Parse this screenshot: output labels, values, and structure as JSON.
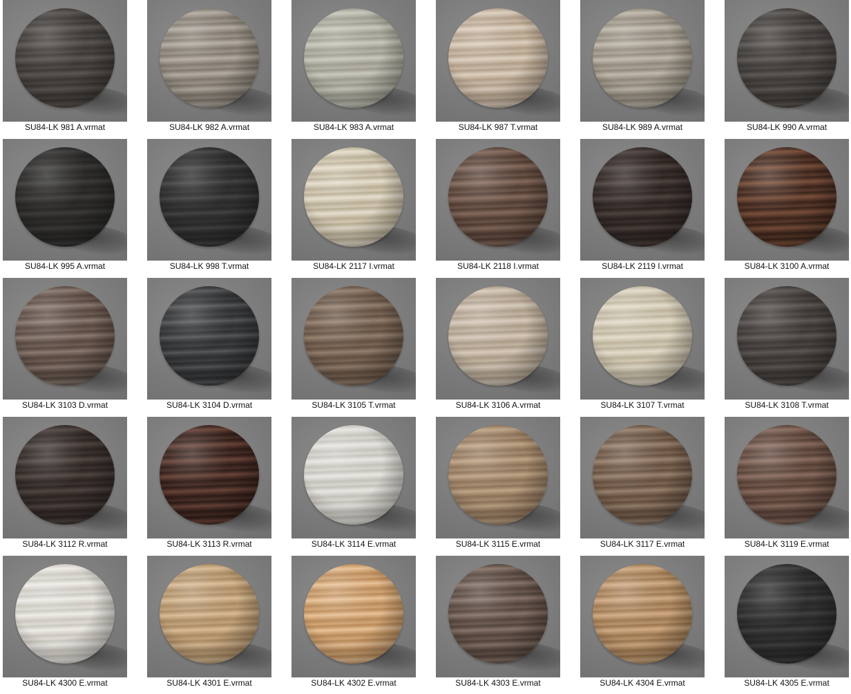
{
  "materials": [
    {
      "label": "SU84-LK 981 A.vrmat",
      "base": "#4a4643",
      "grain": "#3a3633",
      "hi": "#5a5550"
    },
    {
      "label": "SU84-LK 982 A.vrmat",
      "base": "#9a9288",
      "grain": "#7f776c",
      "hi": "#b3aca2"
    },
    {
      "label": "SU84-LK 983 A.vrmat",
      "base": "#b4b3a6",
      "grain": "#9c9b8e",
      "hi": "#cac9bd"
    },
    {
      "label": "SU84-LK 987 T.vrmat",
      "base": "#c9b8a4",
      "grain": "#b09e89",
      "hi": "#ddd0c0"
    },
    {
      "label": "SU84-LK 989 A.vrmat",
      "base": "#a9a193",
      "grain": "#8f877a",
      "hi": "#c0b9ad"
    },
    {
      "label": "SU84-LK 990 A.vrmat",
      "base": "#4b4744",
      "grain": "#3c3835",
      "hi": "#5e5955"
    },
    {
      "label": "SU84-LK 995 A.vrmat",
      "base": "#2f2e2d",
      "grain": "#262524",
      "hi": "#3c3b3a"
    },
    {
      "label": "SU84-LK 998 T.vrmat",
      "base": "#333232",
      "grain": "#2a2929",
      "hi": "#444343"
    },
    {
      "label": "SU84-LK 2117 I.vrmat",
      "base": "#d2c8b2",
      "grain": "#b8ad95",
      "hi": "#e5dece"
    },
    {
      "label": "SU84-LK 2118 I.vrmat",
      "base": "#6b5347",
      "grain": "#503c32",
      "hi": "#846a5d"
    },
    {
      "label": "SU84-LK 2119 I.vrmat",
      "base": "#3a302d",
      "grain": "#2a2220",
      "hi": "#4d423e"
    },
    {
      "label": "SU84-LK 3100 A.vrmat",
      "base": "#5a3a2c",
      "grain": "#3a241b",
      "hi": "#7a4f3a"
    },
    {
      "label": "SU84-LK 3103 D.vrmat",
      "base": "#6e5e55",
      "grain": "#56473f",
      "hi": "#8a7a70"
    },
    {
      "label": "SU84-LK 3104 D.vrmat",
      "base": "#3d3e40",
      "grain": "#2e2f31",
      "hi": "#55575a"
    },
    {
      "label": "SU84-LK 3105 T.vrmat",
      "base": "#7a6656",
      "grain": "#614f41",
      "hi": "#947f6e"
    },
    {
      "label": "SU84-LK 3106 A.vrmat",
      "base": "#c2b4a2",
      "grain": "#aa9b88",
      "hi": "#d6cabb"
    },
    {
      "label": "SU84-LK 3107 T.vrmat",
      "base": "#d2c9b4",
      "grain": "#bcb29c",
      "hi": "#e3dccb"
    },
    {
      "label": "SU84-LK 3108 T.vrmat",
      "base": "#4a4542",
      "grain": "#3a3532",
      "hi": "#5d5754"
    },
    {
      "label": "SU84-LK 3112 R.vrmat",
      "base": "#3c3330",
      "grain": "#2c2421",
      "hi": "#504541"
    },
    {
      "label": "SU84-LK 3113 R.vrmat",
      "base": "#4a2f28",
      "grain": "#2f1c17",
      "hi": "#6a4438"
    },
    {
      "label": "SU84-LK 3114 E.vrmat",
      "base": "#d7d5cf",
      "grain": "#c4c1ba",
      "hi": "#e7e6e2"
    },
    {
      "label": "SU84-LK 3115 E.vrmat",
      "base": "#a68b6e",
      "grain": "#8c725a",
      "hi": "#bfa588"
    },
    {
      "label": "SU84-LK 3117 E.vrmat",
      "base": "#7d6654",
      "grain": "#634e3e",
      "hi": "#99826f"
    },
    {
      "label": "SU84-LK 3119 E.vrmat",
      "base": "#6f5549",
      "grain": "#553f35",
      "hi": "#8a6d60"
    },
    {
      "label": "SU84-LK 4300 E.vrmat",
      "base": "#dedbd5",
      "grain": "#cbc7c0",
      "hi": "#eeece8"
    },
    {
      "label": "SU84-LK 4301 E.vrmat",
      "base": "#c2a27a",
      "grain": "#a88a64",
      "hi": "#d8bc97"
    },
    {
      "label": "SU84-LK 4302 E.vrmat",
      "base": "#d3a675",
      "grain": "#b88a5b",
      "hi": "#e8c29a"
    },
    {
      "label": "SU84-LK 4303 E.vrmat",
      "base": "#6b5a50",
      "grain": "#52433a",
      "hi": "#877469"
    },
    {
      "label": "SU84-LK 4304 E.vrmat",
      "base": "#b8926a",
      "grain": "#9a7650",
      "hi": "#d0ab85"
    },
    {
      "label": "SU84-LK 4305 E.vrmat",
      "base": "#313131",
      "grain": "#282828",
      "hi": "#404040"
    }
  ]
}
